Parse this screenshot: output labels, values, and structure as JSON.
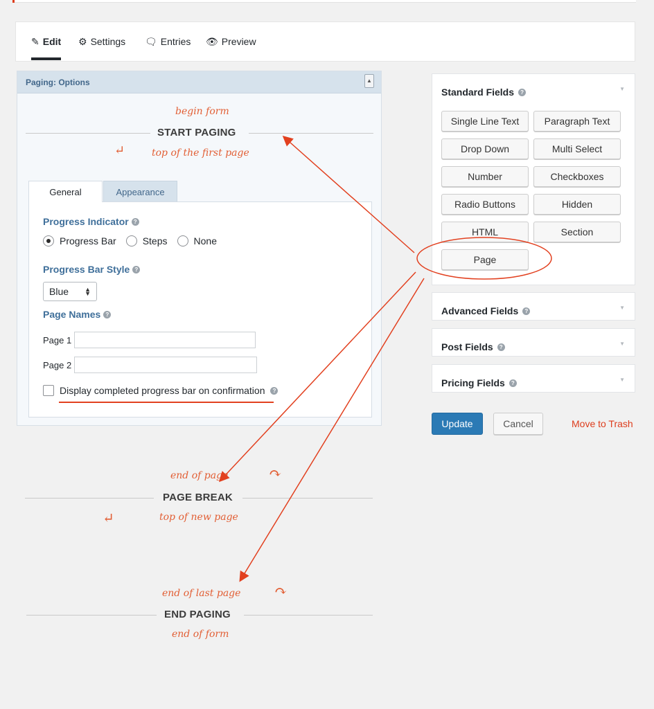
{
  "nav": {
    "edit": "Edit",
    "settings": "Settings",
    "entries": "Entries",
    "preview": "Preview"
  },
  "paging_options": {
    "title": "Paging: Options",
    "tabs": {
      "general": "General",
      "appearance": "Appearance"
    },
    "progress_indicator": {
      "label": "Progress Indicator",
      "options": [
        "Progress Bar",
        "Steps",
        "None"
      ],
      "selected": "Progress Bar"
    },
    "progress_bar_style": {
      "label": "Progress Bar Style",
      "value": "Blue"
    },
    "page_names": {
      "label": "Page Names",
      "page1": "Page 1",
      "page2": "Page 2"
    },
    "display_completed_label": "Display completed progress bar on confirmation"
  },
  "canvas": {
    "start_paging": "START PAGING",
    "page_break": "PAGE BREAK",
    "end_paging": "END PAGING"
  },
  "annotations": {
    "begin_form": "begin form",
    "top_of_first_page": "top of the first page",
    "end_of_page": "end of page",
    "top_of_new_page": "top of new page",
    "end_of_last_page": "end of last page",
    "end_of_form": "end of form"
  },
  "sidebar": {
    "standard_fields": {
      "title": "Standard Fields",
      "buttons": [
        "Single Line Text",
        "Paragraph Text",
        "Drop Down",
        "Multi Select",
        "Number",
        "Checkboxes",
        "Radio Buttons",
        "Hidden",
        "HTML",
        "Section",
        "Page"
      ]
    },
    "advanced_fields": "Advanced Fields",
    "post_fields": "Post Fields",
    "pricing_fields": "Pricing Fields"
  },
  "actions": {
    "update": "Update",
    "cancel": "Cancel",
    "trash": "Move to Trash"
  },
  "colors": {
    "annotation": "#e25f35",
    "primary": "#2b7ab5",
    "label_blue": "#3f6f9a"
  }
}
